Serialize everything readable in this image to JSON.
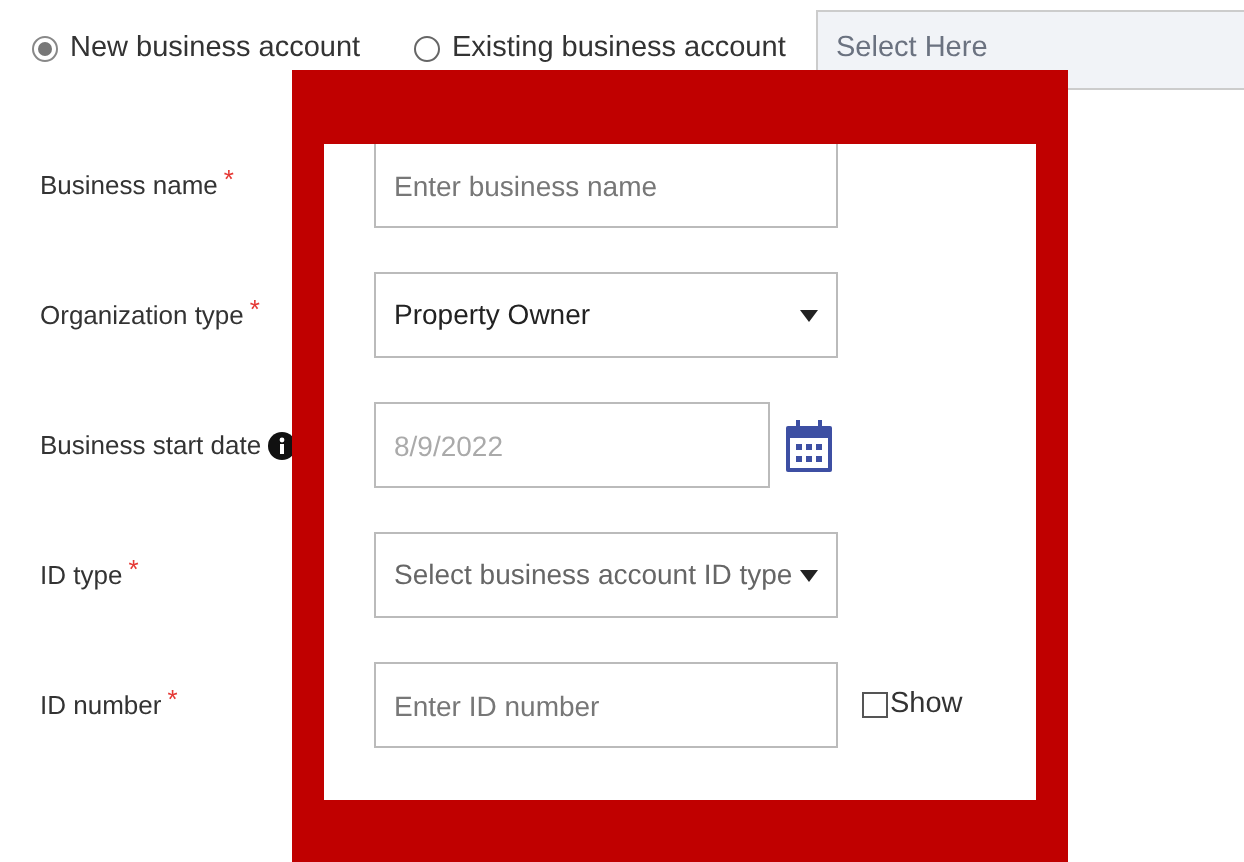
{
  "account_type": [
    {
      "label": "New business account",
      "selected": true
    },
    {
      "label": "Existing business account",
      "selected": false
    }
  ],
  "account_select": {
    "placeholder": "Select Here"
  },
  "fields": [
    {
      "kind": "text",
      "label": "Business name",
      "required_mark": "*",
      "placeholder": "Enter business name"
    },
    {
      "kind": "select",
      "label": "Organization type",
      "required_mark": "*",
      "value": "Property Owner"
    },
    {
      "kind": "date",
      "label": "Business start date",
      "info": true,
      "value": "8/9/2022",
      "disabled": true
    },
    {
      "kind": "select",
      "label": "ID type",
      "required_mark": "*",
      "placeholder": "Select business account ID type"
    },
    {
      "kind": "text",
      "label": "ID number",
      "required_mark": "*",
      "placeholder": "Enter ID number",
      "show_toggle": {
        "label": "Show",
        "checked": false
      }
    }
  ]
}
